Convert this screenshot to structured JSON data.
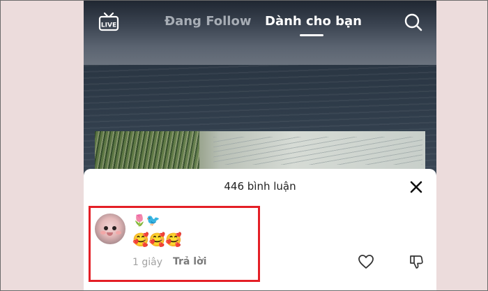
{
  "header": {
    "following_tab": "Đang Follow",
    "for_you_tab": "Dành cho bạn",
    "live_label": "LIVE"
  },
  "comments_sheet": {
    "title": "446 bình luận",
    "comment": {
      "line1": "🌷🐦",
      "line2": "🥰🥰🥰",
      "timestamp": "1 giây",
      "reply_label": "Trả lời"
    }
  },
  "icons": [
    "live-icon",
    "search-icon",
    "close-icon",
    "heart-icon",
    "dislike-icon"
  ],
  "colors": {
    "highlight": "#e41f26",
    "active_tab": "#ffffff",
    "inactive_tab": "#a7adb5",
    "page_background": "#ecdcdc"
  }
}
